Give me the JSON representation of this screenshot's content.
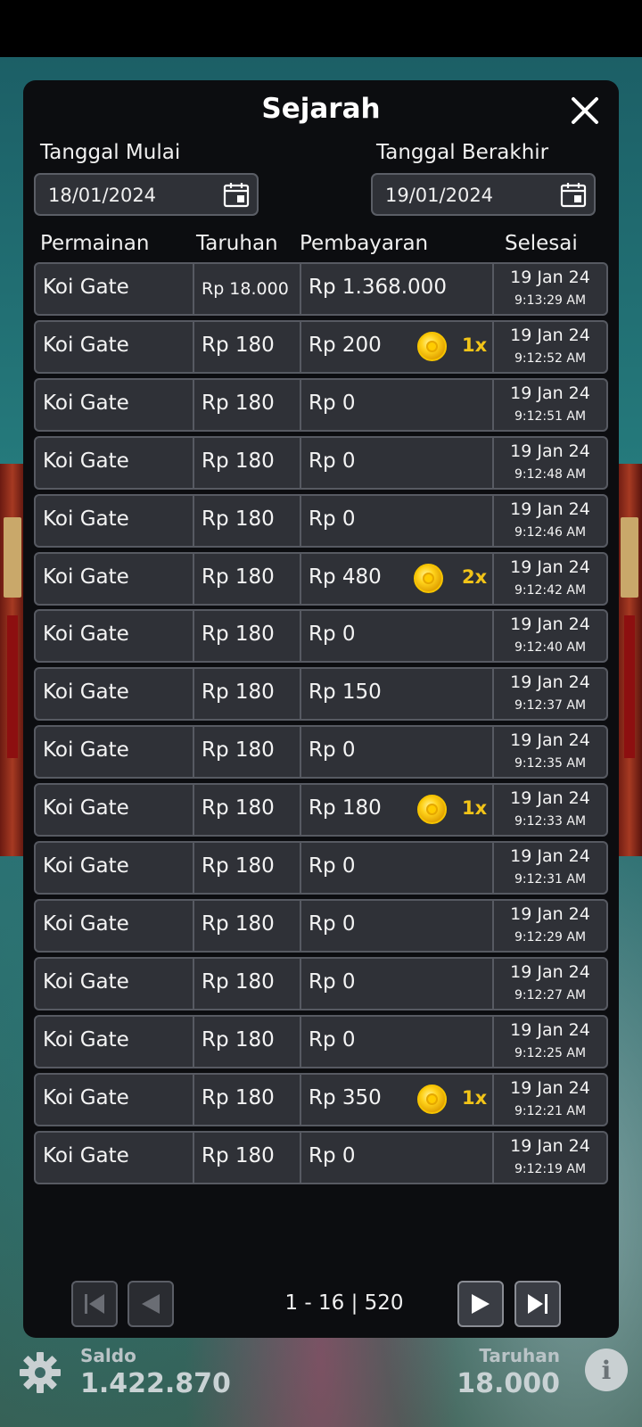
{
  "panel": {
    "title": "Sejarah",
    "start_date_label": "Tanggal Mulai",
    "start_date_value": "18/01/2024",
    "end_date_label": "Tanggal Berakhir",
    "end_date_value": "19/01/2024",
    "columns": [
      "Permainan",
      "Taruhan",
      "Pembayaran",
      "Selesai"
    ],
    "rows": [
      {
        "game": "Koi Gate",
        "bet": "Rp 18.000",
        "payout": "Rp 1.368.000",
        "date": "19 Jan 24",
        "time": "9:13:29 AM",
        "multiplier": ""
      },
      {
        "game": "Koi Gate",
        "bet": "Rp 180",
        "payout": "Rp 200",
        "date": "19 Jan 24",
        "time": "9:12:52 AM",
        "multiplier": "1x"
      },
      {
        "game": "Koi Gate",
        "bet": "Rp 180",
        "payout": "Rp 0",
        "date": "19 Jan 24",
        "time": "9:12:51 AM",
        "multiplier": ""
      },
      {
        "game": "Koi Gate",
        "bet": "Rp 180",
        "payout": "Rp 0",
        "date": "19 Jan 24",
        "time": "9:12:48 AM",
        "multiplier": ""
      },
      {
        "game": "Koi Gate",
        "bet": "Rp 180",
        "payout": "Rp 0",
        "date": "19 Jan 24",
        "time": "9:12:46 AM",
        "multiplier": ""
      },
      {
        "game": "Koi Gate",
        "bet": "Rp 180",
        "payout": "Rp 480",
        "date": "19 Jan 24",
        "time": "9:12:42 AM",
        "multiplier": "2x"
      },
      {
        "game": "Koi Gate",
        "bet": "Rp 180",
        "payout": "Rp 0",
        "date": "19 Jan 24",
        "time": "9:12:40 AM",
        "multiplier": ""
      },
      {
        "game": "Koi Gate",
        "bet": "Rp 180",
        "payout": "Rp 150",
        "date": "19 Jan 24",
        "time": "9:12:37 AM",
        "multiplier": ""
      },
      {
        "game": "Koi Gate",
        "bet": "Rp 180",
        "payout": "Rp 0",
        "date": "19 Jan 24",
        "time": "9:12:35 AM",
        "multiplier": ""
      },
      {
        "game": "Koi Gate",
        "bet": "Rp 180",
        "payout": "Rp 180",
        "date": "19 Jan 24",
        "time": "9:12:33 AM",
        "multiplier": "1x"
      },
      {
        "game": "Koi Gate",
        "bet": "Rp 180",
        "payout": "Rp 0",
        "date": "19 Jan 24",
        "time": "9:12:31 AM",
        "multiplier": ""
      },
      {
        "game": "Koi Gate",
        "bet": "Rp 180",
        "payout": "Rp 0",
        "date": "19 Jan 24",
        "time": "9:12:29 AM",
        "multiplier": ""
      },
      {
        "game": "Koi Gate",
        "bet": "Rp 180",
        "payout": "Rp 0",
        "date": "19 Jan 24",
        "time": "9:12:27 AM",
        "multiplier": ""
      },
      {
        "game": "Koi Gate",
        "bet": "Rp 180",
        "payout": "Rp 0",
        "date": "19 Jan 24",
        "time": "9:12:25 AM",
        "multiplier": ""
      },
      {
        "game": "Koi Gate",
        "bet": "Rp 180",
        "payout": "Rp 350",
        "date": "19 Jan 24",
        "time": "9:12:21 AM",
        "multiplier": "1x"
      },
      {
        "game": "Koi Gate",
        "bet": "Rp 180",
        "payout": "Rp 0",
        "date": "19 Jan 24",
        "time": "9:12:19 AM",
        "multiplier": ""
      }
    ],
    "pagination": {
      "info": "1 - 16 | 520",
      "first_icon": "skip-first-icon",
      "prev_icon": "prev-icon",
      "next_icon": "next-icon",
      "last_icon": "skip-last-icon"
    }
  },
  "footer": {
    "balance_label": "Saldo",
    "balance_value": "1.422.870",
    "bet_label": "Taruhan",
    "bet_value": "18.000",
    "settings_icon": "gear-icon",
    "info_icon": "info-icon"
  },
  "colors": {
    "panel_bg": "#0c0d10",
    "row_bg": "#2f3137",
    "row_border": "#575a62",
    "multiplier": "#f2c418",
    "coin": "#ffd21a"
  }
}
